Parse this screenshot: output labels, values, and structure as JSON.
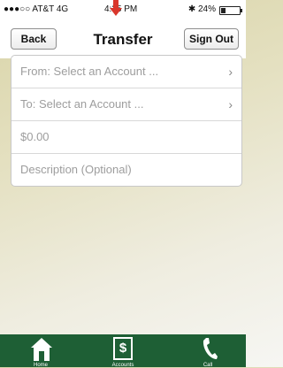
{
  "status_bar": {
    "carrier": "●●●○○ AT&T  4G",
    "time": "4:35 PM",
    "battery": "✱ 24%"
  },
  "nav": {
    "back_label": "Back",
    "title": "Transfer",
    "signout_label": "Sign Out"
  },
  "form": {
    "from_placeholder": "From: Select an Account ...",
    "to_placeholder": "To: Select an Account ...",
    "amount_placeholder": "$0.00",
    "description_placeholder": "Description (Optional)"
  },
  "tabs": {
    "home": "Home",
    "accounts": "Accounts",
    "call": "Call"
  },
  "colors": {
    "tab_bar": "#1e5f35",
    "annotation_arrow": "#d9372c"
  }
}
